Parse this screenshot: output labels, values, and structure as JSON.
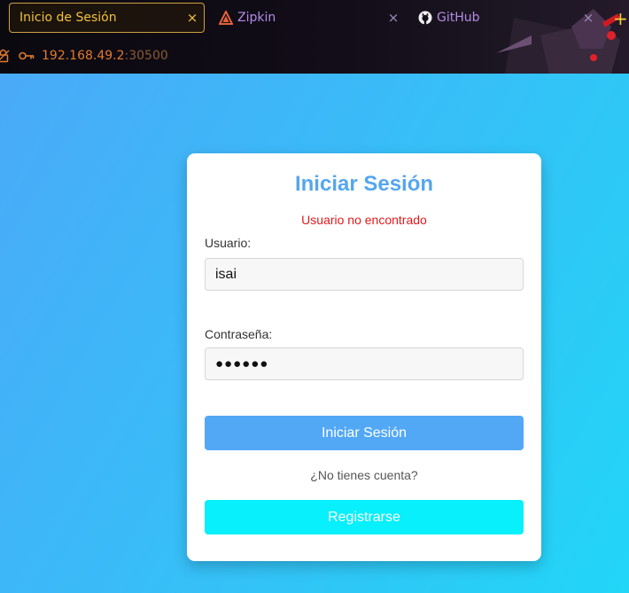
{
  "browser": {
    "tabs": [
      {
        "label": "Inicio de Sesión",
        "active": true
      },
      {
        "label": "Zipkin",
        "active": false,
        "icon": "zipkin-icon"
      },
      {
        "label": "GitHub",
        "active": false,
        "icon": "github-icon"
      }
    ],
    "close_glyph": "×",
    "new_tab_glyph": "+",
    "url": {
      "host": "192.168.49.2",
      "port": ":30500"
    }
  },
  "login": {
    "title": "Iniciar Sesión",
    "error": "Usuario no encontrado",
    "username_label": "Usuario:",
    "username_value": "isai",
    "password_label": "Contraseña:",
    "password_value": "●●●●●●",
    "login_button": "Iniciar Sesión",
    "no_account_text": "¿No tienes cuenta?",
    "register_button": "Registrarse"
  },
  "colors": {
    "accent_title": "#55a6ee",
    "error": "#e3191b",
    "login_button": "#52a8f5",
    "register_button": "#07f0fb",
    "tab_active": "#f2c23c",
    "url": "#e07a2e"
  }
}
